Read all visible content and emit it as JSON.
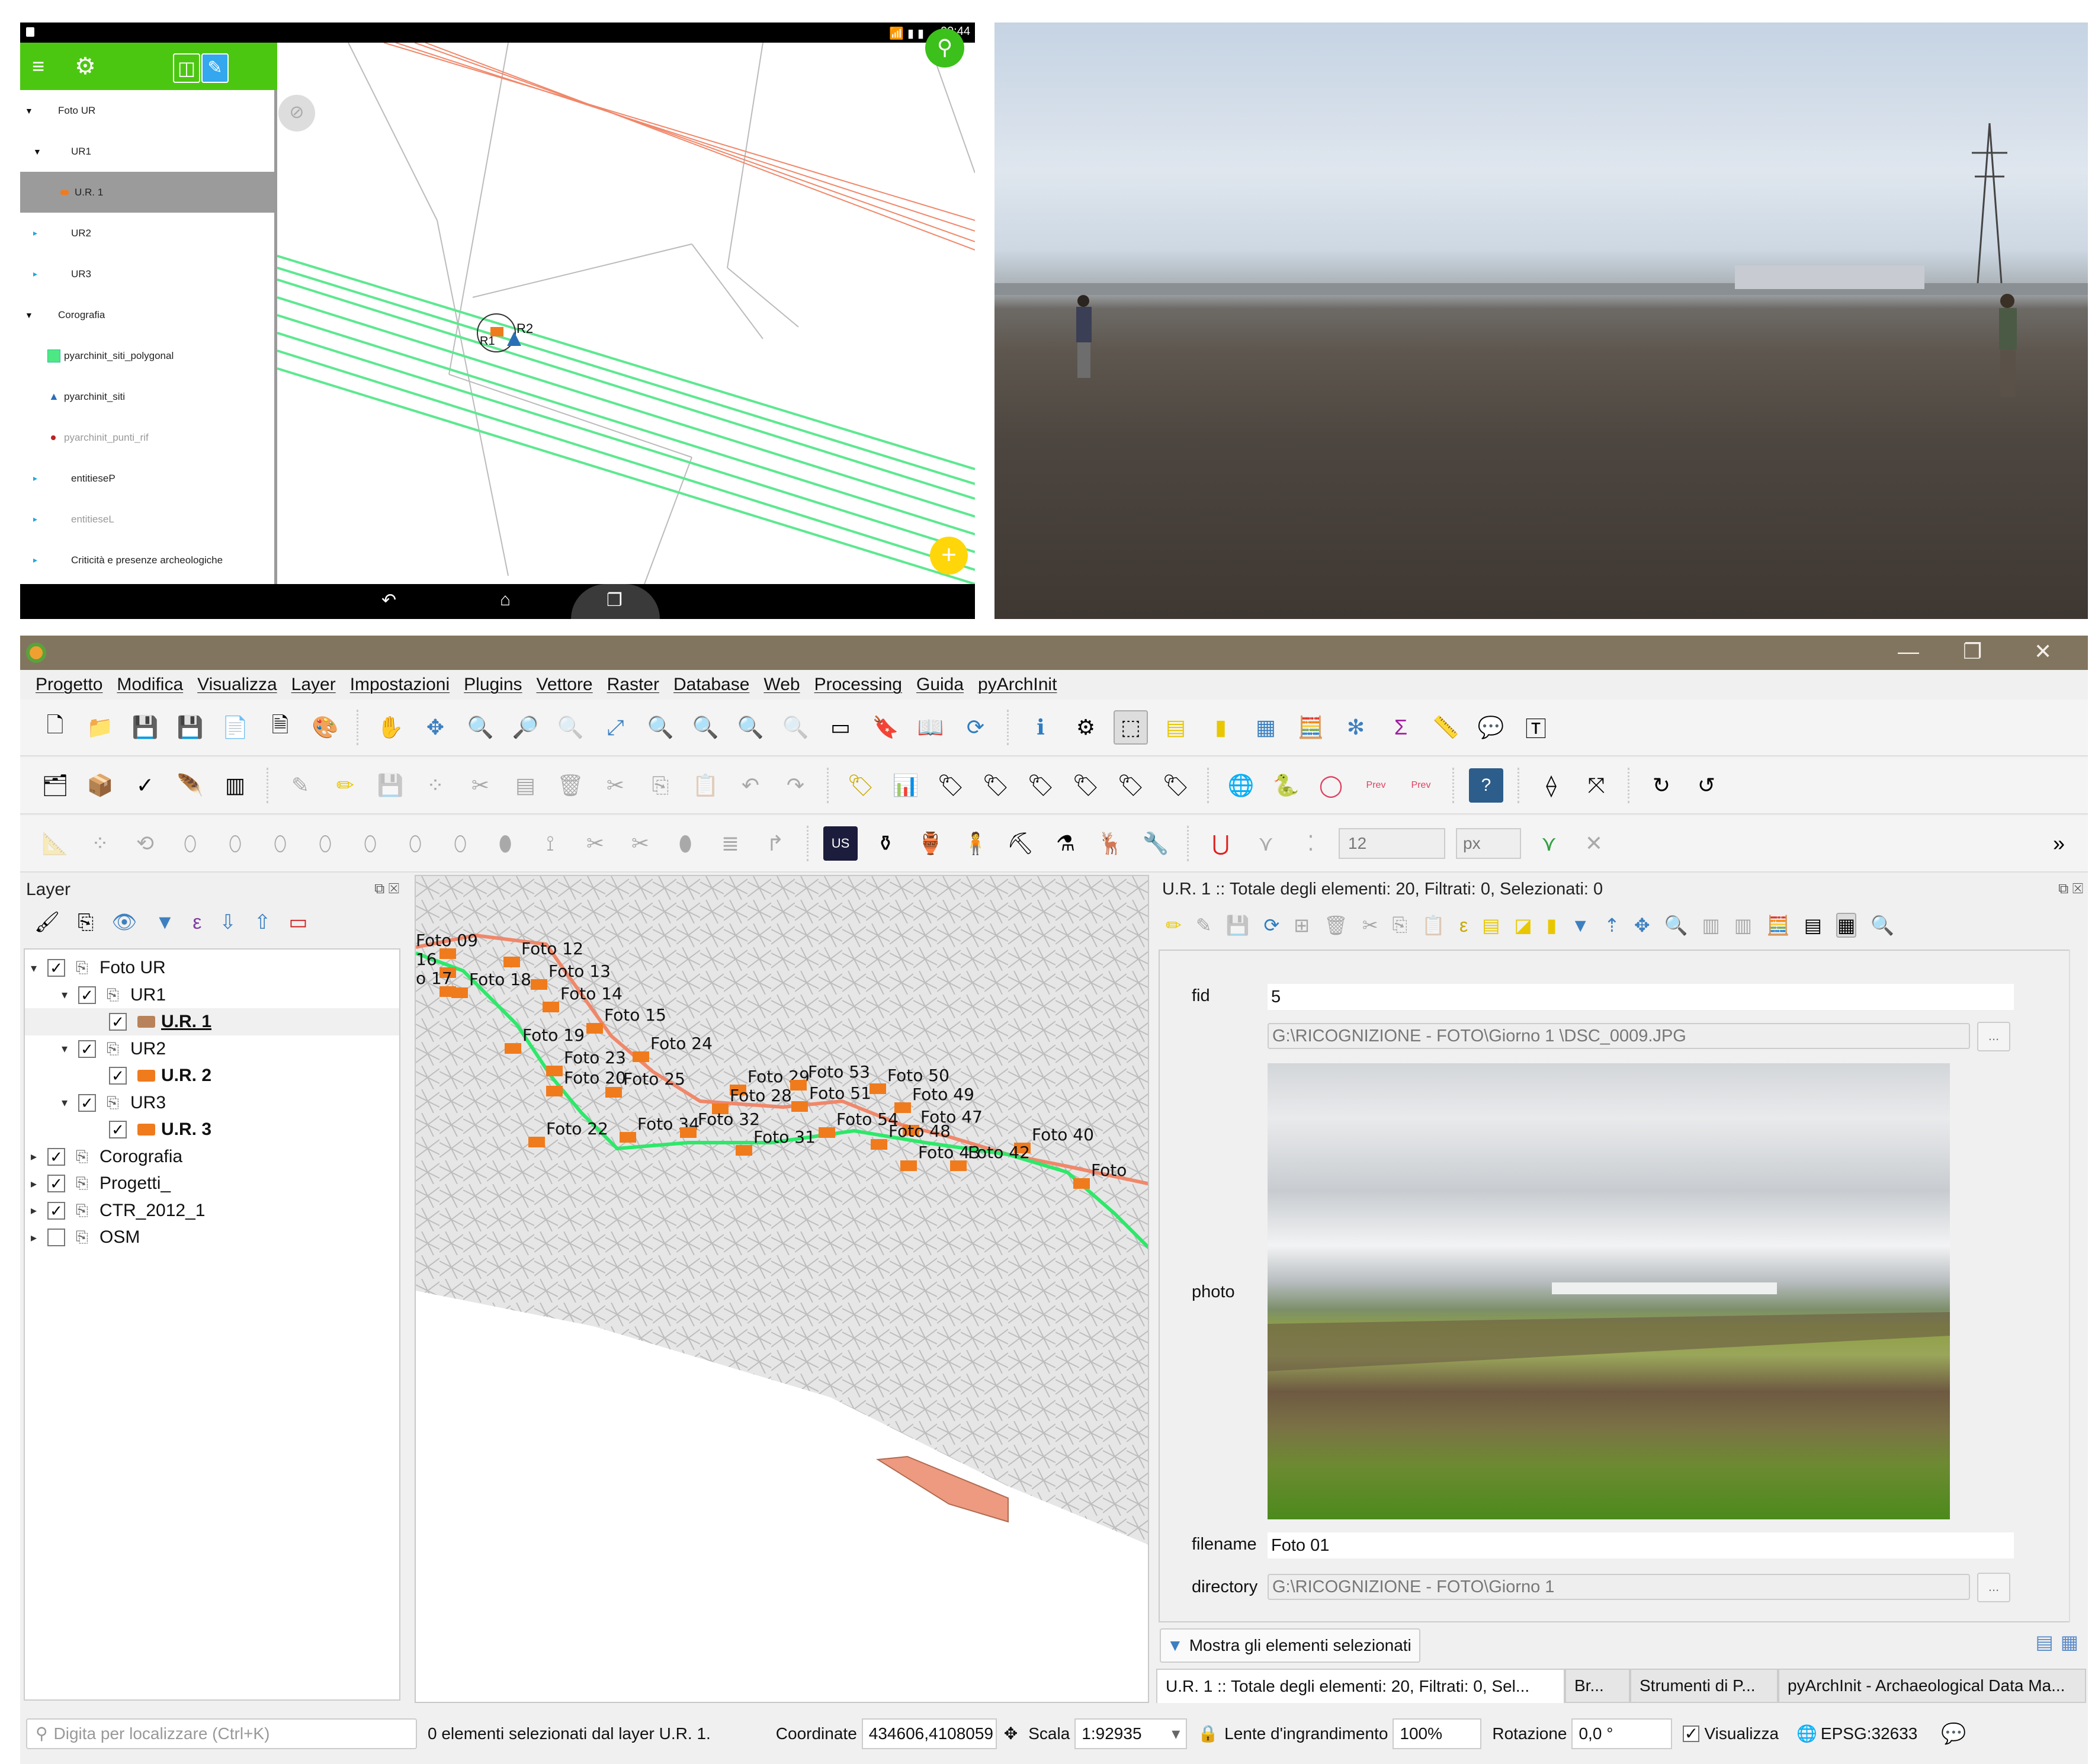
{
  "android": {
    "status_bar": {
      "time": "00:44"
    },
    "toolbar": {
      "menu_icon": "hamburger-icon",
      "settings_icon": "gear-icon",
      "map_mode_icon": "map-icon",
      "edit_mode_icon": "pencil-icon"
    },
    "layer_tree": [
      {
        "label": "Foto UR",
        "level": 0,
        "expanded": true,
        "kind": "group"
      },
      {
        "label": "UR1",
        "level": 1,
        "expanded": true,
        "kind": "group"
      },
      {
        "label": "U.R. 1",
        "level": 2,
        "kind": "layer",
        "selected": true,
        "symbol": "orange-camera"
      },
      {
        "label": "UR2",
        "level": 1,
        "expanded": false,
        "kind": "group"
      },
      {
        "label": "UR3",
        "level": 1,
        "expanded": false,
        "kind": "group"
      },
      {
        "label": "Corografia",
        "level": 0,
        "expanded": true,
        "kind": "group"
      },
      {
        "label": "pyarchinit_siti_polygonal",
        "level": 1,
        "kind": "layer",
        "symbol": "green-square"
      },
      {
        "label": "pyarchinit_siti",
        "level": 1,
        "kind": "layer",
        "symbol": "blue-triangle"
      },
      {
        "label": "pyarchinit_punti_rif",
        "level": 1,
        "kind": "layer",
        "symbol": "red-dot",
        "dimmed": true
      },
      {
        "label": "entitieseP",
        "level": 1,
        "expanded": false,
        "kind": "group"
      },
      {
        "label": "entitieseL",
        "level": 1,
        "expanded": false,
        "kind": "group",
        "dimmed": true
      },
      {
        "label": "Criticità e presenze archeologiche",
        "level": 1,
        "expanded": false,
        "kind": "group"
      }
    ],
    "map_labels": {
      "r1": "R1",
      "r2": "R2"
    },
    "fab_search_icon": "search-icon",
    "fab_add_label": "+",
    "nav": {
      "back": "back-icon",
      "home": "home-icon",
      "recents": "recents-icon"
    }
  },
  "field_photo": {
    "description": "Ploughed field survey with two archaeologists and an electricity pylon"
  },
  "qgis": {
    "menu": [
      "Progetto",
      "Modifica",
      "Visualizza",
      "Layer",
      "Impostazioni",
      "Plugins",
      "Vettore",
      "Raster",
      "Database",
      "Web",
      "Processing",
      "Guida",
      "pyArchInit"
    ],
    "snapping": {
      "tolerance": "12",
      "unit": "px"
    },
    "layer_panel": {
      "title": "Layer",
      "tree": [
        {
          "label": "Foto UR",
          "level": 0,
          "checked": true,
          "expanded": true,
          "kind": "group"
        },
        {
          "label": "UR1",
          "level": 1,
          "checked": true,
          "expanded": true,
          "kind": "group"
        },
        {
          "label": "U.R. 1",
          "level": 2,
          "checked": true,
          "kind": "layer",
          "bold": true,
          "underline": true,
          "selected": true,
          "color": "#b8835a"
        },
        {
          "label": "UR2",
          "level": 1,
          "checked": true,
          "expanded": true,
          "kind": "group"
        },
        {
          "label": "U.R. 2",
          "level": 2,
          "checked": true,
          "kind": "layer",
          "bold": true,
          "color": "#f07b1d"
        },
        {
          "label": "UR3",
          "level": 1,
          "checked": true,
          "expanded": true,
          "kind": "group"
        },
        {
          "label": "U.R. 3",
          "level": 2,
          "checked": true,
          "kind": "layer",
          "bold": true,
          "color": "#f07b1d"
        },
        {
          "label": "Corografia",
          "level": 0,
          "checked": true,
          "expanded": false,
          "kind": "group"
        },
        {
          "label": "Progetti_",
          "level": 0,
          "checked": true,
          "expanded": false,
          "kind": "group"
        },
        {
          "label": "CTR_2012_1",
          "level": 0,
          "checked": true,
          "expanded": false,
          "kind": "group"
        },
        {
          "label": "OSM",
          "level": 0,
          "checked": false,
          "expanded": false,
          "kind": "group"
        }
      ]
    },
    "map": {
      "photo_labels": [
        "Foto 09",
        "16",
        "o 17",
        "Foto 12",
        "Foto 13",
        "Foto 18",
        "Foto 14",
        "Foto 15",
        "Foto 19",
        "Foto 23",
        "Foto 24",
        "Foto 20",
        "Foto 25",
        "Foto 29",
        "Foto 28",
        "Foto 53",
        "Foto 50",
        "Foto 51",
        "Foto 49",
        "Foto 54",
        "Foto 47",
        "Foto 22",
        "Foto 34",
        "Foto 32",
        "Foto 31",
        "Foto 48",
        "Foto 40",
        "Foto 43",
        "Foto 42",
        "Foto"
      ]
    },
    "form_panel": {
      "title": "U.R. 1 :: Totale degli elementi: 20, Filtrati: 0, Selezionati: 0",
      "fields": {
        "fid_label": "fid",
        "fid_value": "5",
        "path_value": "G:\\RICOGNIZIONE        - FOTO\\Giorno 1      \\DSC_0009.JPG",
        "photo_label": "photo",
        "filename_label": "filename",
        "filename_value": "Foto 01",
        "directory_label": "directory",
        "directory_value": "G:\\RICOGNIZIONE        - FOTO\\Giorno 1",
        "browse_label": "..."
      },
      "show_selected_label": "Mostra gli elementi selezionati",
      "dock_tabs": [
        "U.R. 1 :: Totale degli elementi: 20, Filtrati: 0, Sel...",
        "Br...",
        "Strumenti di P...",
        "pyArchInit - Archaeological Data Ma..."
      ]
    },
    "status_bar": {
      "locator_placeholder": "Digita per localizzare (Ctrl+K)",
      "message": "0 elementi selezionati dal layer U.R. 1.",
      "coord_label": "Coordinate",
      "coord_value": "434606,4108059",
      "scale_label": "Scala",
      "scale_value": "1:92935",
      "magnifier_label": "Lente d'ingrandimento",
      "magnifier_value": "100%",
      "rotation_label": "Rotazione",
      "rotation_value": "0,0 °",
      "render_label": "Visualizza",
      "render_checked": true,
      "crs": "EPSG:32633"
    },
    "colors": {
      "title_bar": "#82755f",
      "android_green": "#4cc711",
      "photo_point": "#f07b1d",
      "track_green": "#2ee86a",
      "track_salmon": "#f0876a"
    }
  }
}
